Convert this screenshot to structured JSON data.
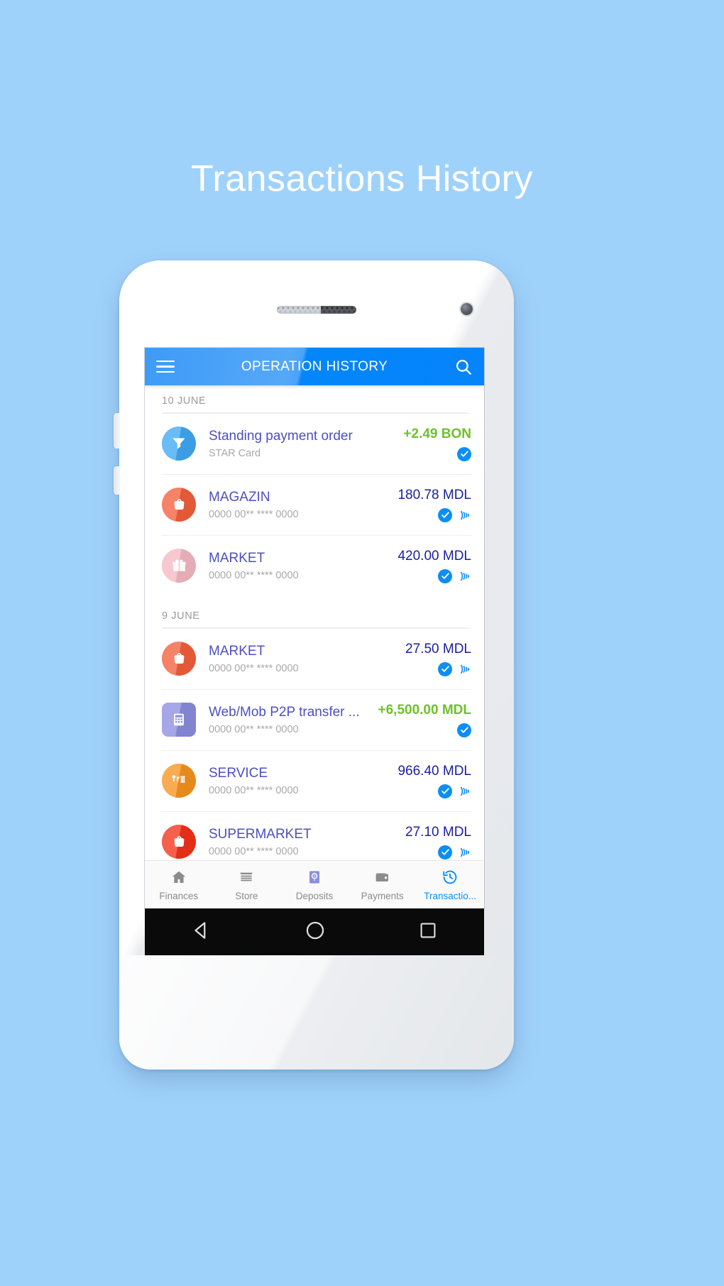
{
  "page": {
    "title": "Transactions History",
    "background_color": "#9fd2fb",
    "title_color": "#ffffff"
  },
  "app": {
    "appbar": {
      "menu_icon": "hamburger-menu-icon",
      "title": "OPERATION HISTORY",
      "search_icon": "search-icon",
      "accent_color": "#0b8ef5"
    },
    "groups": [
      {
        "date": "10 JUNE",
        "transactions": [
          {
            "title": "Standing payment order",
            "subtitle": "STAR Card",
            "amount": "+2.49 BON",
            "credit": true,
            "icon": "funnel-icon",
            "icon_color": "#3fa9f5",
            "badges": [
              "check-icon"
            ]
          },
          {
            "title": "MAGAZIN",
            "subtitle": "0000 00** **** 0000",
            "amount": "180.78 MDL",
            "credit": false,
            "icon": "shopping-basket-icon",
            "icon_color": "#f4603c",
            "badges": [
              "check-icon",
              "contactless-icon"
            ]
          },
          {
            "title": "MARKET",
            "subtitle": "0000 00** **** 0000",
            "amount": "420.00 MDL",
            "credit": false,
            "icon": "gift-box-icon",
            "icon_color": "#f6b9c4",
            "badges": [
              "check-icon",
              "contactless-icon"
            ]
          }
        ]
      },
      {
        "date": "9 JUNE",
        "transactions": [
          {
            "title": "MARKET",
            "subtitle": "0000 00** **** 0000",
            "amount": "27.50 MDL",
            "credit": false,
            "icon": "shopping-basket-icon",
            "icon_color": "#f4603c",
            "badges": [
              "check-icon",
              "contactless-icon"
            ]
          },
          {
            "title": "Web/Mob P2P transfer ...",
            "subtitle": "0000 00** **** 0000",
            "amount": "+6,500.00 MDL",
            "credit": true,
            "icon": "calculator-icon",
            "icon_color": "#8c8ee0",
            "badges": [
              "check-icon"
            ]
          },
          {
            "title": "SERVICE",
            "subtitle": "0000 00** **** 0000",
            "amount": "966.40 MDL",
            "credit": false,
            "icon": "utilities-icon",
            "icon_color": "#f79420",
            "badges": [
              "check-icon",
              "contactless-icon"
            ]
          },
          {
            "title": "SUPERMARKET",
            "subtitle": "0000 00** **** 0000",
            "amount": "27.10 MDL",
            "credit": false,
            "icon": "shopping-basket-icon",
            "icon_color": "#f4321a",
            "badges": [
              "check-icon",
              "contactless-icon"
            ]
          }
        ]
      }
    ],
    "tabs": [
      {
        "label": "Finances",
        "icon": "home-icon",
        "active": false
      },
      {
        "label": "Store",
        "icon": "store-icon",
        "active": false
      },
      {
        "label": "Deposits",
        "icon": "safe-vault-icon",
        "active": false
      },
      {
        "label": "Payments",
        "icon": "wallet-icon",
        "active": false
      },
      {
        "label": "Transactio...",
        "icon": "history-clock-icon",
        "active": true
      }
    ],
    "system_nav": {
      "back": "back-triangle-icon",
      "home": "home-circle-icon",
      "recents": "recents-square-icon"
    }
  },
  "colors": {
    "credit_green": "#6ec12a",
    "debit_navy": "#1a1f9e",
    "title_violet": "#4d4fc4",
    "muted_gray": "#a9a9a9",
    "check_blue": "#0b8ef5"
  }
}
